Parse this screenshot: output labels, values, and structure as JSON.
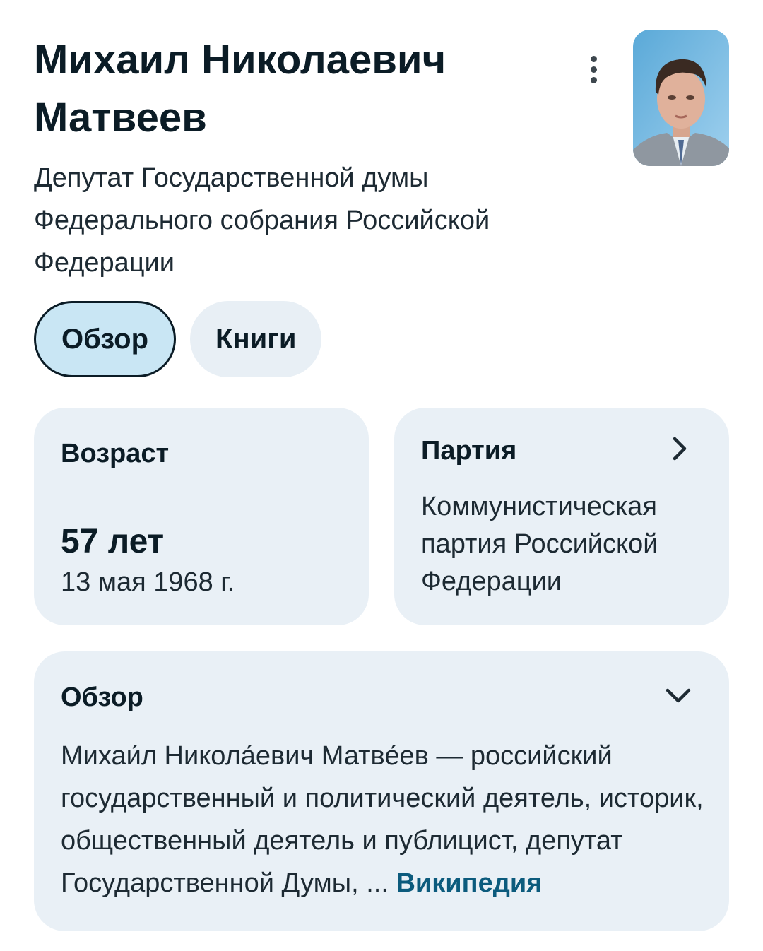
{
  "header": {
    "title": "Михаил Николаевич Матвеев",
    "subtitle": "Депутат Государственной думы Федерального собрания Российской Федерации",
    "menu_icon": "more-vert-icon",
    "photo_alt": "portrait-photo"
  },
  "tabs": [
    {
      "label": "Обзор",
      "active": true
    },
    {
      "label": "Книги",
      "active": false
    }
  ],
  "age_card": {
    "label": "Возраст",
    "value": "57 лет",
    "date": "13 мая 1968 г."
  },
  "party_card": {
    "label": "Партия",
    "value": "Коммунистическая партия Российской Федерации",
    "icon": "chevron-right-icon"
  },
  "overview_card": {
    "label": "Обзор",
    "icon": "chevron-down-icon",
    "text": "Михаи́л Никола́евич Матве́ев — российский государственный и политический деятель, историк, общественный деятель и публицист, депутат Государственной Думы, ...",
    "source": "Википедия"
  },
  "colors": {
    "card_bg": "#e9f0f6",
    "active_chip_bg": "#c9e6f4",
    "link": "#0c5b7d",
    "title": "#0b1c26"
  }
}
